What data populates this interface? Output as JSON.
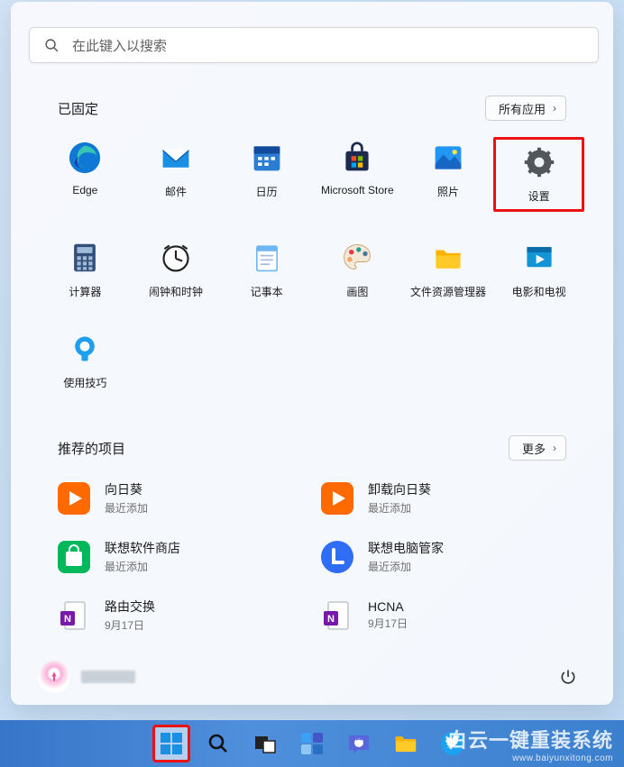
{
  "search": {
    "placeholder": "在此键入以搜索"
  },
  "pinned": {
    "label": "已固定",
    "all_btn": "所有应用",
    "apps": [
      {
        "name": "Edge"
      },
      {
        "name": "邮件"
      },
      {
        "name": "日历"
      },
      {
        "name": "Microsoft Store"
      },
      {
        "name": "照片"
      },
      {
        "name": "设置"
      },
      {
        "name": "计算器"
      },
      {
        "name": "闹钟和时钟"
      },
      {
        "name": "记事本"
      },
      {
        "name": "画图"
      },
      {
        "name": "文件资源管理器"
      },
      {
        "name": "电影和电视"
      },
      {
        "name": "使用技巧"
      }
    ]
  },
  "recommended": {
    "label": "推荐的项目",
    "more_btn": "更多",
    "items": [
      {
        "title": "向日葵",
        "sub": "最近添加"
      },
      {
        "title": "卸载向日葵",
        "sub": "最近添加"
      },
      {
        "title": "联想软件商店",
        "sub": "最近添加"
      },
      {
        "title": "联想电脑管家",
        "sub": "最近添加"
      },
      {
        "title": "路由交换",
        "sub": "9月17日"
      },
      {
        "title": "HCNA",
        "sub": "9月17日"
      }
    ]
  },
  "watermark": {
    "line1": "白云一键重装系统",
    "line2": "www.baiyunxitong.com"
  }
}
